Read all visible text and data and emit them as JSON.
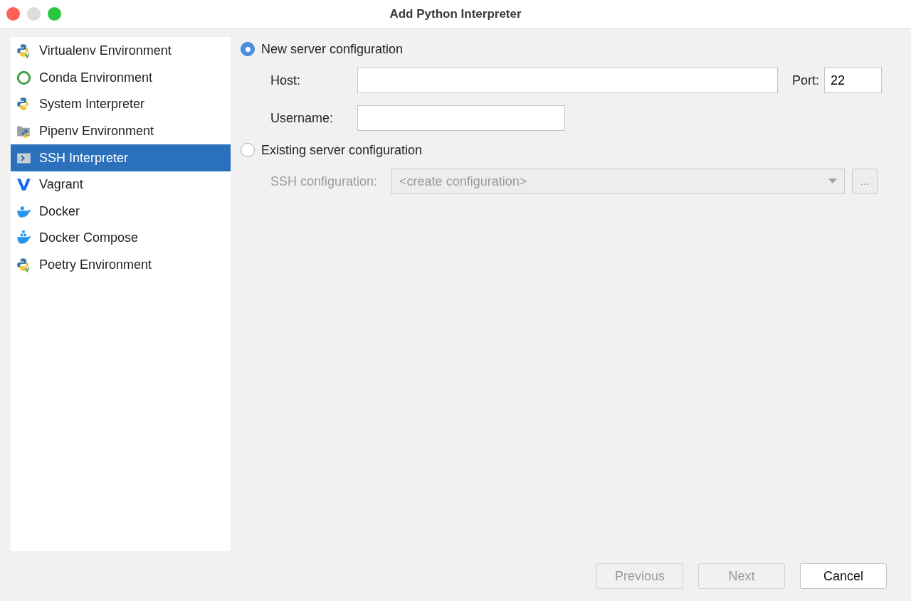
{
  "window": {
    "title": "Add Python Interpreter"
  },
  "sidebar": {
    "items": [
      {
        "label": "Virtualenv Environment",
        "kind": "virtualenv",
        "selected": false
      },
      {
        "label": "Conda Environment",
        "kind": "conda",
        "selected": false
      },
      {
        "label": "System Interpreter",
        "kind": "python",
        "selected": false
      },
      {
        "label": "Pipenv Environment",
        "kind": "pipenv",
        "selected": false
      },
      {
        "label": "SSH Interpreter",
        "kind": "ssh",
        "selected": true
      },
      {
        "label": "Vagrant",
        "kind": "vagrant",
        "selected": false
      },
      {
        "label": "Docker",
        "kind": "docker",
        "selected": false
      },
      {
        "label": "Docker Compose",
        "kind": "compose",
        "selected": false
      },
      {
        "label": "Poetry Environment",
        "kind": "virtualenv",
        "selected": false
      }
    ]
  },
  "new_server": {
    "label": "New server configuration",
    "selected": true,
    "host": {
      "label": "Host:"
    },
    "port": {
      "label": "Port:",
      "value": "22"
    },
    "username": {
      "label": "Username:"
    }
  },
  "existing_server": {
    "label": "Existing server configuration",
    "selected": false,
    "ssh_configuration": {
      "label": "SSH configuration:",
      "value": "<create configuration>",
      "disabled": true
    },
    "browse_button": {
      "label": "...",
      "disabled": true
    }
  },
  "buttons": [
    {
      "label": "Previous",
      "disabled": true
    },
    {
      "label": "Next",
      "disabled": true
    },
    {
      "label": "Cancel",
      "disabled": false
    }
  ]
}
